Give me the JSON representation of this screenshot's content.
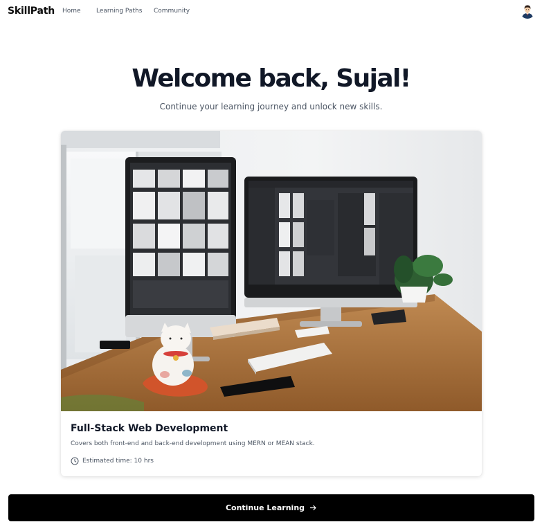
{
  "app": {
    "brand": "SkillPath"
  },
  "nav": {
    "items": [
      {
        "label": "Home"
      },
      {
        "label": "Learning Paths"
      },
      {
        "label": "Community"
      }
    ],
    "avatar_icon": "user-avatar-icon"
  },
  "hero": {
    "title": "Welcome back, Sujal!",
    "subtitle": "Continue your learning journey and unlock new skills."
  },
  "course": {
    "image_subject": "desk with two monitors",
    "title": "Full-Stack Web Development",
    "description": "Covers both front-end and back-end development using MERN or MEAN stack.",
    "meta_icon": "clock-icon",
    "estimated_time": "Estimated time: 10 hrs"
  },
  "cta": {
    "label": "Continue Learning",
    "icon": "arrow-right-icon"
  },
  "colors": {
    "text_primary": "#111827",
    "text_secondary": "#4b5563",
    "button_bg": "#000000",
    "button_text": "#ffffff",
    "page_bg": "#ffffff"
  }
}
